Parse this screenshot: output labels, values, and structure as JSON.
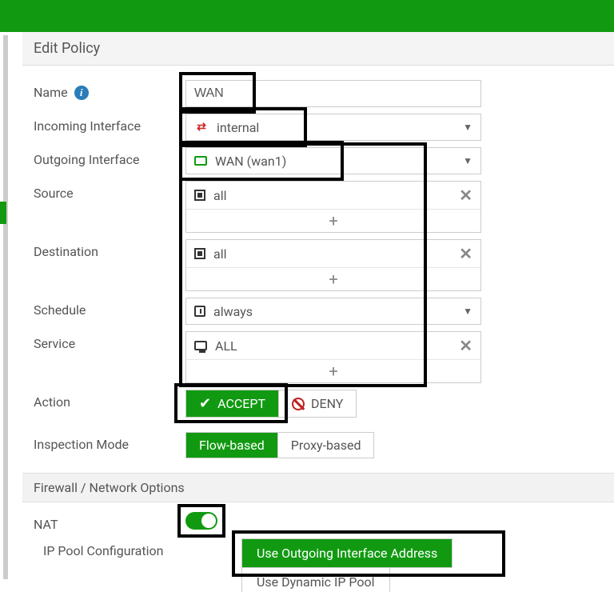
{
  "page": {
    "title": "Edit Policy"
  },
  "labels": {
    "name": "Name",
    "incoming": "Incoming Interface",
    "outgoing": "Outgoing Interface",
    "source": "Source",
    "destination": "Destination",
    "schedule": "Schedule",
    "service": "Service",
    "action": "Action",
    "inspection": "Inspection Mode",
    "section_fw": "Firewall / Network Options",
    "nat": "NAT",
    "ippool": "IP Pool Configuration"
  },
  "values": {
    "name": "WAN",
    "incoming": "internal",
    "outgoing": "WAN (wan1)",
    "source_item": "all",
    "destination_item": "all",
    "schedule": "always",
    "service_item": "ALL"
  },
  "action": {
    "accept": "ACCEPT",
    "deny": "DENY",
    "selected": "accept"
  },
  "inspection": {
    "flow": "Flow-based",
    "proxy": "Proxy-based",
    "selected": "flow"
  },
  "nat": {
    "enabled": true
  },
  "ippool": {
    "use_outgoing": "Use Outgoing Interface Address",
    "use_dynamic": "Use Dynamic IP Pool",
    "selected": "use_outgoing"
  },
  "glyphs": {
    "plus": "+",
    "times": "✕",
    "chevdown": "▼",
    "check": "✔"
  }
}
